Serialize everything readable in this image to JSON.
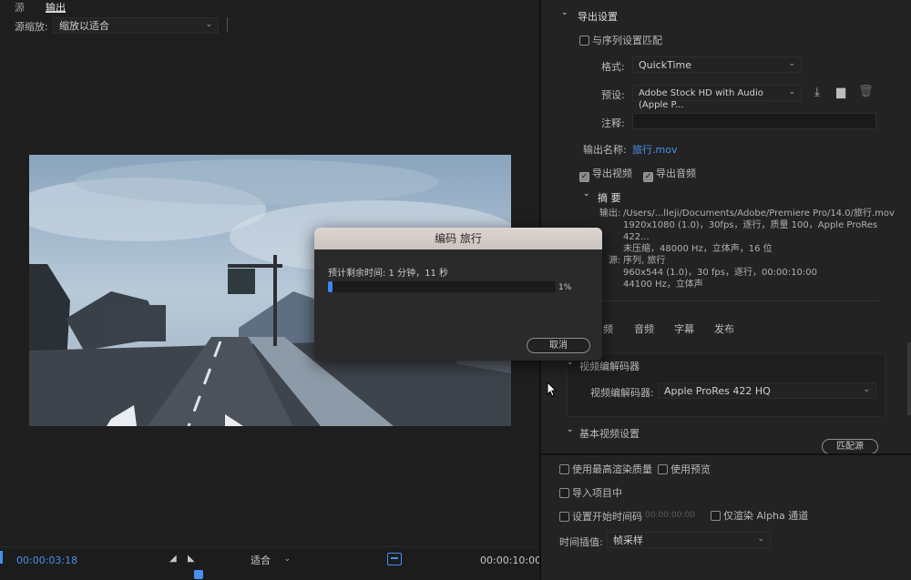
{
  "source_monitor": {
    "tabs": [
      {
        "label": "源"
      },
      {
        "label": "输出"
      }
    ],
    "scale_label": "源缩放:",
    "scale_value": "缩放以适合"
  },
  "timeline": {
    "current_time": "00:00:03:18",
    "fit_value": "适合",
    "duration": "00:00:10:00"
  },
  "export_settings": {
    "section_title": "导出设置",
    "match_sequence_label": "与序列设置匹配",
    "format_label": "格式:",
    "format_value": "QuickTime",
    "preset_label": "预设:",
    "preset_value": "Adobe Stock HD with Audio (Apple P...",
    "comment_label": "注释:",
    "comment_value": "",
    "output_name_label": "输出名称:",
    "output_name_value": "旅行.mov",
    "export_video_label": "导出视频",
    "export_audio_label": "导出音频",
    "summary_title": "摘 要",
    "summary_output_label": "输出:",
    "summary_output_lines": [
      "/Users/...lleji/Documents/Adobe/Premiere Pro/14.0/旅行.mov",
      "1920x1080 (1.0)，30fps，逐行，质量 100，Apple ProRes 422...",
      "未压缩，48000 Hz，立体声，16 位"
    ],
    "summary_source_label": "源:",
    "summary_source_lines": [
      "序列, 旅行",
      "960x544 (1.0)，30 fps，逐行，00:00:10:00",
      "44100 Hz，立体声"
    ]
  },
  "tabs2": [
    {
      "label": "频"
    },
    {
      "label": "音频"
    },
    {
      "label": "字幕"
    },
    {
      "label": "发布"
    }
  ],
  "video_codec": {
    "section_title": "视频编解码器",
    "codec_label": "视频编解码器:",
    "codec_value": "Apple ProRes 422 HQ"
  },
  "basic_video": {
    "section_title": "基本视频设置",
    "match_source_button": "匹配源"
  },
  "bottom_options": {
    "max_render_quality": "使用最高渲染质量",
    "use_previews": "使用预览",
    "import_into_project": "导入项目中",
    "set_start_timecode": "设置开始时间码",
    "start_timecode_value": "00:00:00:00",
    "render_alpha_only": "仅渲染 Alpha 通道",
    "time_interpolation_label": "时间插值:",
    "time_interpolation_value": "帧采样"
  },
  "dialog": {
    "title": "编码 旅行",
    "remaining_label": "预计剩余时间: 1 分钟，11 秒",
    "progress_fraction": 0.01,
    "progress_text": "1%",
    "cancel_button": "取消"
  },
  "icons": {
    "import_preset": "import-preset-icon",
    "save_preset": "save-preset-icon",
    "delete_preset": "trash-icon"
  },
  "colors": {
    "accent": "#4a8ff0",
    "dialog_title_bg": "#d6ceca"
  }
}
